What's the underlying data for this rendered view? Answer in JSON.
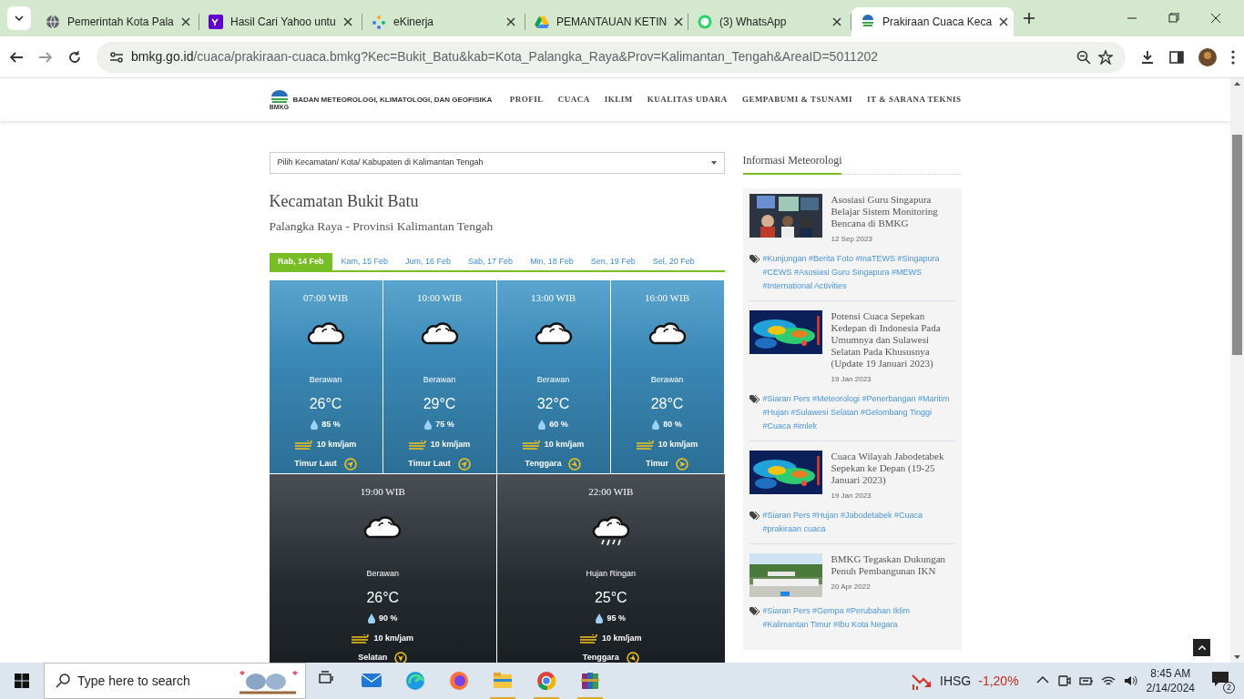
{
  "browser": {
    "tabs": [
      {
        "title": "Pemerintah Kota Pala",
        "selected": false
      },
      {
        "title": "Hasil Cari Yahoo untu",
        "selected": false
      },
      {
        "title": "eKinerja",
        "selected": false
      },
      {
        "title": "PEMANTAUAN KETIN",
        "selected": false
      },
      {
        "title": "(3) WhatsApp",
        "selected": false
      },
      {
        "title": "Prakiraan Cuaca Keca",
        "selected": true
      }
    ],
    "url": {
      "host": "bmkg.go.id",
      "path": "/cuaca/prakiraan-cuaca.bmkg?Kec=Bukit_Batu&kab=Kota_Palangka_Raya&Prov=Kalimantan_Tengah&AreaID=5011202"
    }
  },
  "site": {
    "logo_text": "BMKG",
    "org_name": "BADAN METEOROLOGI, KLIMATOLOGI, DAN GEOFISIKA",
    "nav": [
      "PROFIL",
      "CUACA",
      "IKLIM",
      "KUALITAS UDARA",
      "GEMPABUMI & TSUNAMI",
      "IT & SARANA TEKNIS"
    ]
  },
  "region_select": {
    "value": "Pilih Kecamatan/ Kota/ Kabupaten di Kalimantan Tengah"
  },
  "location": {
    "title": "Kecamatan Bukit Batu",
    "subtitle": "Palangka Raya - Provinsi Kalimantan Tengah"
  },
  "days": [
    {
      "label": "Rab, 14 Feb",
      "selected": true
    },
    {
      "label": "Kam, 15 Feb",
      "selected": false
    },
    {
      "label": "Jum, 16 Feb",
      "selected": false
    },
    {
      "label": "Sab, 17 Feb",
      "selected": false
    },
    {
      "label": "Min, 18 Feb",
      "selected": false
    },
    {
      "label": "Sen, 19 Feb",
      "selected": false
    },
    {
      "label": "Sel, 20 Feb",
      "selected": false
    }
  ],
  "forecasts": [
    {
      "time": "07:00 WIB",
      "kind": "cloudy",
      "weather": "Berawan",
      "temp": "26°C",
      "humidity": "85 %",
      "wind_speed": "10 km/jam",
      "wind_dir": "Timur Laut"
    },
    {
      "time": "10:00 WIB",
      "kind": "cloudy",
      "weather": "Berawan",
      "temp": "29°C",
      "humidity": "75 %",
      "wind_speed": "10 km/jam",
      "wind_dir": "Timur Laut"
    },
    {
      "time": "13:00 WIB",
      "kind": "cloudy",
      "weather": "Berawan",
      "temp": "32°C",
      "humidity": "60 %",
      "wind_speed": "10 km/jam",
      "wind_dir": "Tenggara"
    },
    {
      "time": "16:00 WIB",
      "kind": "cloudy",
      "weather": "Berawan",
      "temp": "28°C",
      "humidity": "80 %",
      "wind_speed": "10 km/jam",
      "wind_dir": "Timur"
    },
    {
      "time": "19:00 WIB",
      "kind": "cloudy",
      "weather": "Berawan",
      "temp": "26°C",
      "humidity": "90 %",
      "wind_speed": "10 km/jam",
      "wind_dir": "Selatan"
    },
    {
      "time": "22:00 WIB",
      "kind": "rain",
      "weather": "Hujan Ringan",
      "temp": "25°C",
      "humidity": "95 %",
      "wind_speed": "10 km/jam",
      "wind_dir": "Tenggara"
    }
  ],
  "sidebar": {
    "title": "Informasi Meteorologi",
    "articles": [
      {
        "kind": "picture",
        "title": "Asosiasi Guru Singapura Belajar Sistem Monitoring Bencana di BMKG",
        "date": "12 Sep 2023",
        "tags": "#Kunjungan #Berita Foto #InaTEWS #Singapura #CEWS #Asosiasi Guru Singapura #MEWS #International Activities"
      },
      {
        "kind": "picture",
        "title": "Potensi Cuaca Sepekan Kedepan di Indonesia Pada Umumnya dan Sulawesi Selatan Pada Khususnya (Update 19 Januari 2023)",
        "date": "19 Jan 2023",
        "tags": "#Siaran Pers #Meteorologi #Penerbangan #Maritim #Hujan #Sulawesi Selatan #Gelombang Tinggi #Cuaca #imlek"
      },
      {
        "kind": "picture",
        "title": "Cuaca Wilayah Jabodetabek Sepekan ke Depan (19-25 Januari 2023)",
        "date": "19 Jan 2023",
        "tags": "#Siaran Pers #Hujan #Jabodetabek #Cuaca #prakiraan cuaca"
      },
      {
        "kind": "picture",
        "title": "BMKG Tegaskan Dukungan Penuh Pembangunan IKN",
        "date": "20 Apr 2022",
        "tags": "#Siaran Pers #Gempa #Perubahan Iklim #Kalimantan Timur #Ibu Kota Negara"
      }
    ]
  },
  "taskbar": {
    "search_placeholder": "Type here to search",
    "stock": {
      "name": "IHSG",
      "change": "-1,20%"
    },
    "time": "8:45 AM",
    "date": "2/14/2024",
    "notifications": "2"
  }
}
